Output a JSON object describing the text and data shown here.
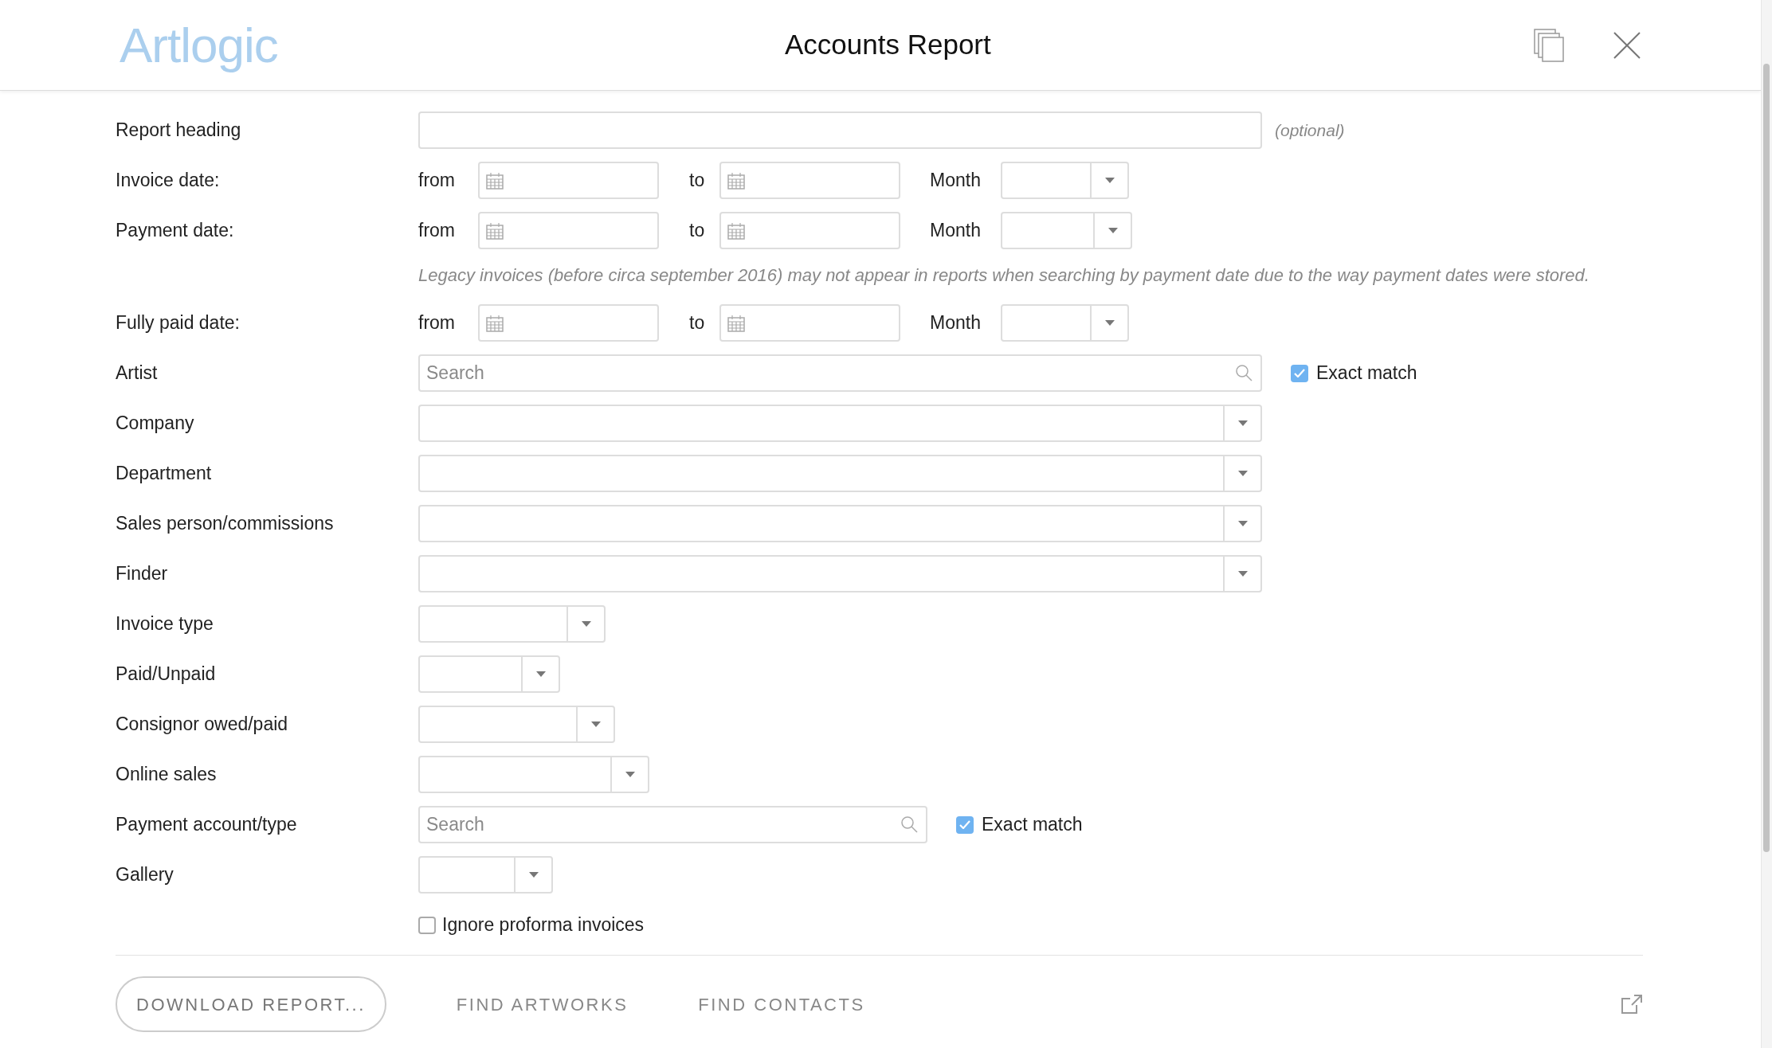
{
  "header": {
    "logo": "Artlogic",
    "title": "Accounts Report"
  },
  "fields": [
    {
      "kind": "text",
      "label": "Report heading",
      "hint": "(optional)"
    },
    {
      "kind": "daterange",
      "label": "Invoice date:",
      "from_label": "from",
      "to_label": "to",
      "month_label": "Month"
    },
    {
      "kind": "daterange",
      "label": "Payment date:",
      "from_label": "from",
      "to_label": "to",
      "month_label": "Month",
      "note": "Legacy invoices (before circa september 2016) may not appear in reports when searching by payment date due to the way payment dates were stored."
    },
    {
      "kind": "daterange",
      "label": "Fully paid date:",
      "from_label": "from",
      "to_label": "to",
      "month_label": "Month"
    },
    {
      "kind": "search",
      "label": "Artist",
      "placeholder": "Search",
      "exact_match": {
        "label": "Exact match",
        "checked": true
      }
    },
    {
      "kind": "select",
      "label": "Company"
    },
    {
      "kind": "select",
      "label": "Department"
    },
    {
      "kind": "select",
      "label": "Sales person/commissions"
    },
    {
      "kind": "select",
      "label": "Finder"
    },
    {
      "kind": "select",
      "label": "Invoice type"
    },
    {
      "kind": "select",
      "label": "Paid/Unpaid"
    },
    {
      "kind": "select",
      "label": "Consignor owed/paid"
    },
    {
      "kind": "select",
      "label": "Online sales"
    },
    {
      "kind": "search",
      "label": "Payment account/type",
      "placeholder": "Search",
      "exact_match": {
        "label": "Exact match",
        "checked": true
      }
    },
    {
      "kind": "select",
      "label": "Gallery"
    },
    {
      "kind": "checkbox",
      "label": "Ignore proforma invoices",
      "checked": false
    }
  ],
  "footer": {
    "buttons": [
      {
        "kind": "outline",
        "label": "DOWNLOAD REPORT..."
      },
      {
        "kind": "link",
        "label": "FIND ARTWORKS"
      },
      {
        "kind": "link",
        "label": "FIND CONTACTS"
      }
    ]
  }
}
